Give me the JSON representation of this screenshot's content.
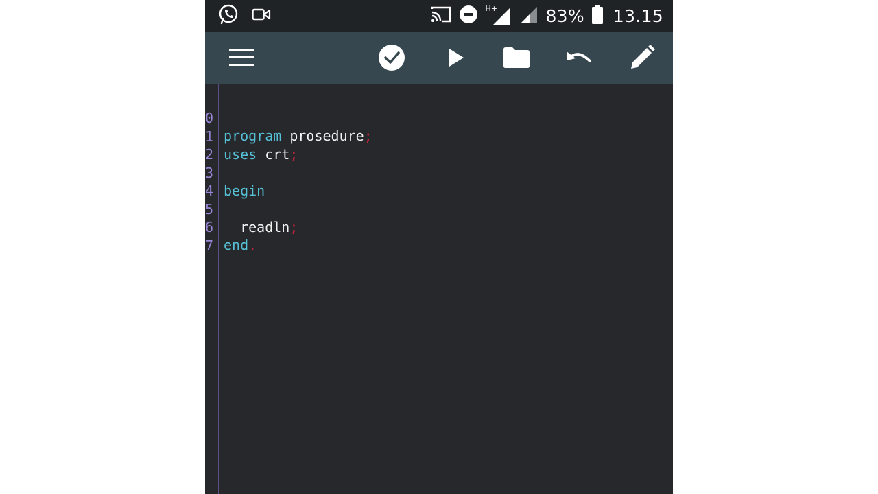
{
  "status_bar": {
    "battery_percent": "83%",
    "time": "13.15",
    "network_type": "H+",
    "icons": [
      "whatsapp-icon",
      "video-icon",
      "cast-icon",
      "do-not-disturb-icon",
      "signal-icon",
      "signal-icon",
      "battery-icon"
    ]
  },
  "toolbar": {
    "icons": [
      "menu-icon",
      "check-icon",
      "play-icon",
      "folder-icon",
      "undo-icon",
      "pencil-icon"
    ]
  },
  "editor": {
    "line_numbers": [
      "0",
      "1",
      "2",
      "3",
      "4",
      "5",
      "6",
      "7"
    ],
    "lines": [
      {
        "kw": "program",
        "id": " prosedure",
        "punct": ";"
      },
      {
        "kw": "uses",
        "id": " crt",
        "punct": ";"
      },
      {
        "kw": "",
        "id": "",
        "punct": ""
      },
      {
        "kw": "begin",
        "id": "",
        "punct": ""
      },
      {
        "kw": "",
        "id": "",
        "punct": ""
      },
      {
        "kw": "",
        "id": "  readln",
        "punct": ";"
      },
      {
        "kw": "end",
        "id": "",
        "punct": "."
      },
      {
        "kw": "",
        "id": "",
        "punct": ""
      }
    ]
  },
  "colors": {
    "keyword": "#56c1d6",
    "punctuation": "#c0233a",
    "line_number": "#9a86d6",
    "toolbar": "#37474f",
    "editor_bg": "#27282c"
  }
}
